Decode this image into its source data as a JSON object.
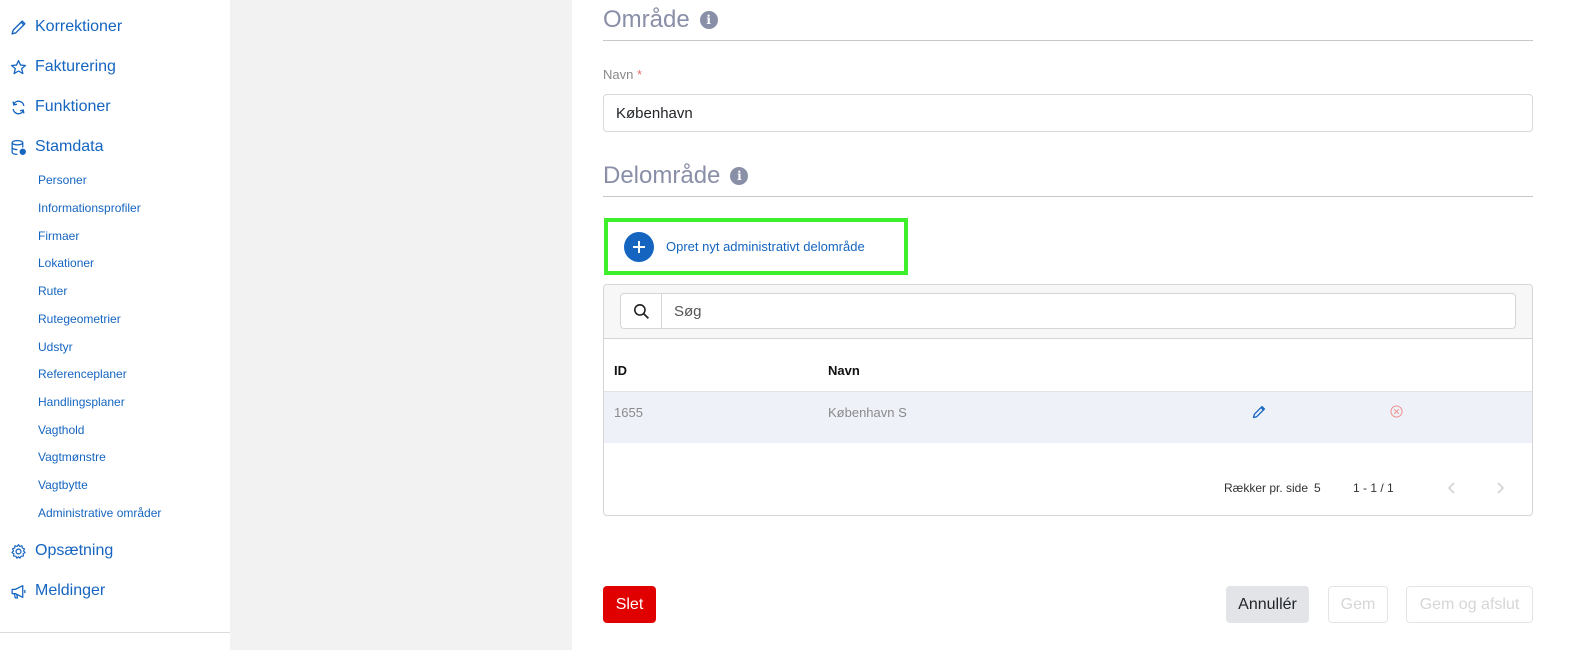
{
  "sidebar": {
    "main_items": [
      {
        "label": "Korrektioner",
        "icon": "pencil-icon"
      },
      {
        "label": "Fakturering",
        "icon": "star-icon"
      },
      {
        "label": "Funktioner",
        "icon": "refresh-icon"
      },
      {
        "label": "Stamdata",
        "icon": "database-icon"
      }
    ],
    "sub_items": [
      "Personer",
      "Informationsprofiler",
      "Firmaer",
      "Lokationer",
      "Ruter",
      "Rutegeometrier",
      "Udstyr",
      "Referenceplaner",
      "Handlingsplaner",
      "Vagthold",
      "Vagtmønstre",
      "Vagtbytte",
      "Administrative områder"
    ],
    "bottom_items": [
      {
        "label": "Opsætning",
        "icon": "gear-icon"
      },
      {
        "label": "Meldinger",
        "icon": "megaphone-icon"
      }
    ]
  },
  "main": {
    "area_section": {
      "title": "Område",
      "info": "i"
    },
    "name_field": {
      "label": "Navn",
      "required_mark": "*",
      "value": "København"
    },
    "subarea_section": {
      "title": "Delområde",
      "info": "i"
    },
    "create_button": {
      "label": "Opret nyt administrativt delområde"
    },
    "table": {
      "search_placeholder": "Søg",
      "columns": [
        "ID",
        "Navn"
      ],
      "rows": [
        {
          "id": "1655",
          "name": "København S"
        }
      ],
      "rows_per_page_label": "Rækker pr. side",
      "rows_per_page_value": "5",
      "page_range": "1 - 1 / 1"
    },
    "buttons": {
      "delete": "Slet",
      "cancel": "Annullér",
      "save": "Gem",
      "save_close": "Gem og afslut"
    }
  },
  "colors": {
    "accent": "#1565c0",
    "highlight_border": "#3ef02c",
    "danger": "#e00000",
    "section_title": "#8a8fa8"
  }
}
